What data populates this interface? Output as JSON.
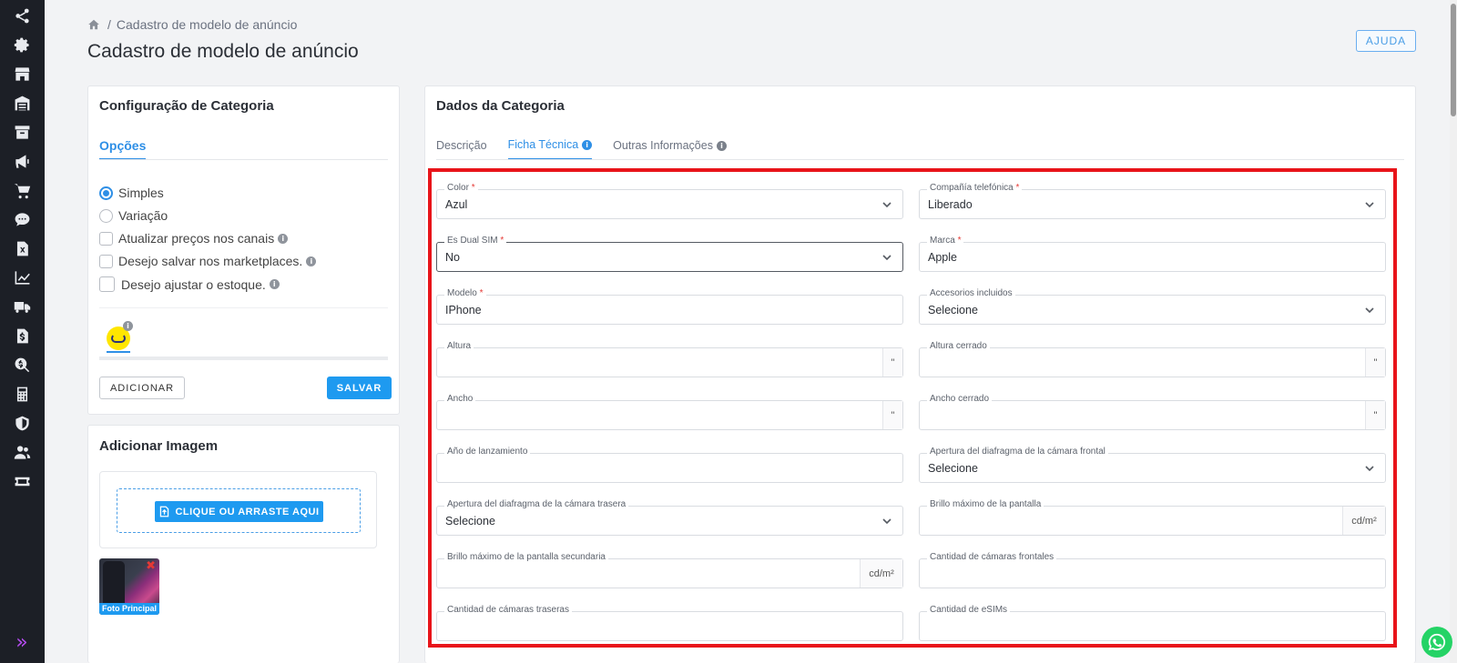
{
  "sidebar": {
    "icons": [
      "share-icon",
      "gear-icon",
      "store-icon",
      "warehouse-icon",
      "archive-icon",
      "megaphone-icon",
      "cart-icon",
      "chat-icon",
      "excel-icon",
      "chart-icon",
      "truck-icon",
      "invoice-icon",
      "search-dollar-icon",
      "calculator-icon",
      "shield-icon",
      "users-icon",
      "ticket-icon"
    ],
    "expand_glyph": "»"
  },
  "breadcrumb": {
    "sep": "/",
    "current": "Cadastro de modelo de anúncio"
  },
  "page_title": "Cadastro de modelo de anúncio",
  "help_label": "AJUDA",
  "config": {
    "title": "Configuração de Categoria",
    "tab": "Opções",
    "options": {
      "simples": "Simples",
      "variacao": "Variação",
      "precos": "Atualizar preços nos canais",
      "salvar_mkt": "Desejo salvar nos marketplaces.",
      "estoque": "Desejo ajustar o estoque."
    },
    "info_glyph": "i",
    "add_label": "ADICIONAR",
    "save_label": "SALVAR"
  },
  "image_card": {
    "title": "Adicionar Imagem",
    "upload_label": "CLIQUE OU ARRASTE AQUI",
    "thumb_label": "Foto Principal",
    "delete_glyph": "✖"
  },
  "dados": {
    "title": "Dados da Categoria",
    "tabs": [
      "Descrição",
      "Ficha Técnica",
      "Outras Informações"
    ],
    "fields": {
      "color": {
        "label": "Color",
        "value": "Azul"
      },
      "compania": {
        "label": "Compañía telefónica",
        "value": "Liberado"
      },
      "dual_sim": {
        "label": "Es Dual SIM",
        "value": "No"
      },
      "marca": {
        "label": "Marca",
        "value": "Apple"
      },
      "modelo": {
        "label": "Modelo",
        "value": "IPhone"
      },
      "accesorios": {
        "label": "Accesorios incluidos",
        "value": "Selecione"
      },
      "altura": {
        "label": "Altura",
        "value": "",
        "unit": "\""
      },
      "altura_cerrado": {
        "label": "Altura cerrado",
        "value": "",
        "unit": "\""
      },
      "ancho": {
        "label": "Ancho",
        "value": "",
        "unit": "\""
      },
      "ancho_cerrado": {
        "label": "Ancho cerrado",
        "value": "",
        "unit": "\""
      },
      "ano": {
        "label": "Año de lanzamiento",
        "value": ""
      },
      "apertura_frontal": {
        "label": "Apertura del diafragma de la cámara frontal",
        "value": "Selecione"
      },
      "apertura_trasera": {
        "label": "Apertura del diafragma de la cámara trasera",
        "value": "Selecione"
      },
      "brillo": {
        "label": "Brillo máximo de la pantalla",
        "value": "",
        "unit": "cd/m²"
      },
      "brillo_sec": {
        "label": "Brillo máximo de la pantalla secundaria",
        "value": "",
        "unit": "cd/m²"
      },
      "cam_frontales": {
        "label": "Cantidad de cámaras frontales",
        "value": ""
      },
      "cam_traseras": {
        "label": "Cantidad de cámaras traseras",
        "value": ""
      },
      "esims": {
        "label": "Cantidad de eSIMs",
        "value": ""
      }
    },
    "required_mark": "*"
  },
  "colors": {
    "accent": "#1e9af0",
    "highlight": "#e8141a",
    "sidebar": "#1c1f26",
    "whatsapp": "#25d366"
  }
}
